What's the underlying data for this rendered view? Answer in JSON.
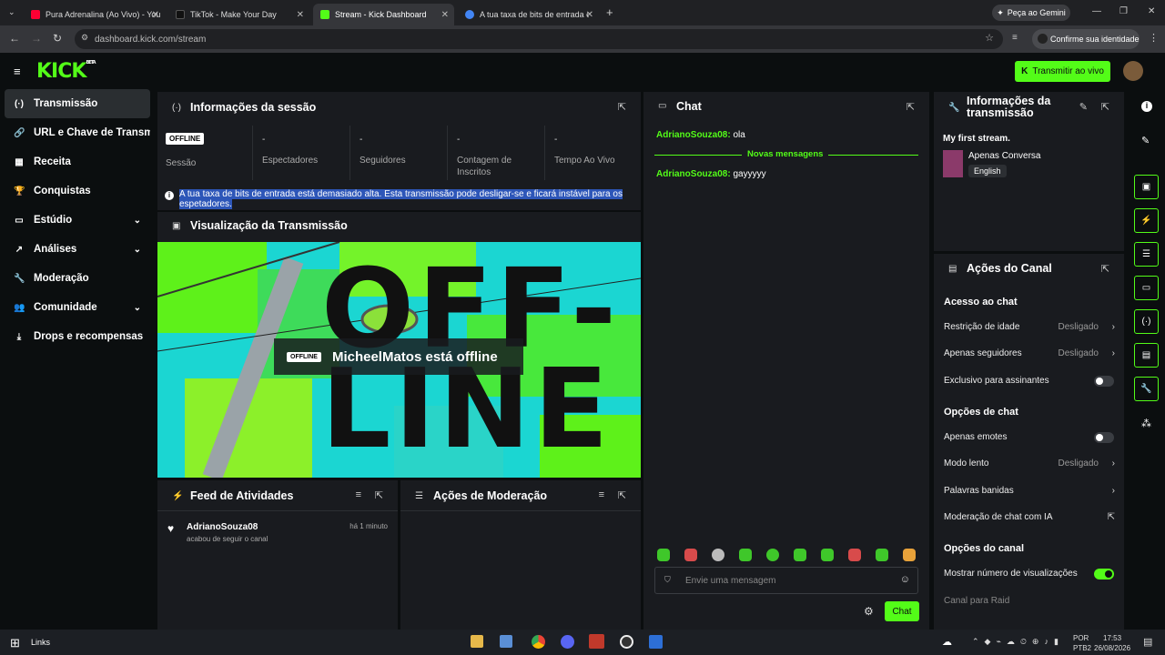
{
  "browser": {
    "tabs": [
      {
        "title": "Pura Adrenalina (Ao Vivo) - You",
        "color": "#ff0033"
      },
      {
        "title": "TikTok - Make Your Day",
        "color": "#000000"
      },
      {
        "title": "Stream - Kick Dashboard",
        "color": "#53fc18"
      },
      {
        "title": "A tua taxa de bits de entrada e",
        "color": "#4285f4"
      }
    ],
    "gemini": "Peça ao Gemini",
    "url": "dashboard.kick.com/stream",
    "identity": "Confirme sua identidade"
  },
  "header": {
    "logo": "KICK",
    "logo_tag": "BETA",
    "live_button": "Transmitir ao vivo"
  },
  "sidebar": {
    "items": [
      {
        "label": "Transmissão",
        "icon": "(·)"
      },
      {
        "label": "URL e Chave de Transmissão",
        "icon": "🔗"
      },
      {
        "label": "Receita",
        "icon": "▦"
      },
      {
        "label": "Conquistas",
        "icon": "🏆"
      },
      {
        "label": "Estúdio",
        "icon": "▭"
      },
      {
        "label": "Análises",
        "icon": "↗"
      },
      {
        "label": "Moderação",
        "icon": "🔧"
      },
      {
        "label": "Comunidade",
        "icon": "👥"
      },
      {
        "label": "Drops e recompensas",
        "icon": "⤓"
      }
    ]
  },
  "session": {
    "title": "Informações da sessão",
    "badge": "OFFLINE",
    "stats": [
      {
        "value": "",
        "label": "Sessão"
      },
      {
        "value": "-",
        "label": "Espectadores"
      },
      {
        "value": "-",
        "label": "Seguidores"
      },
      {
        "value": "-",
        "label": "Contagem de Inscritos"
      },
      {
        "value": "-",
        "label": "Tempo Ao Vivo"
      }
    ],
    "warning": "A tua taxa de bits de entrada está demasiado alta. Esta transmissão pode desligar-se e ficará instável para os espetadores."
  },
  "preview": {
    "title": "Visualização da Transmissão",
    "badge": "OFFLINE",
    "message": "MicheelMatos está offline",
    "bg_text": "OFF-LINE"
  },
  "feed": {
    "title": "Feed de Atividades",
    "user": "AdrianoSouza08",
    "time": "há 1 minuto",
    "action": "acabou de seguir o canal"
  },
  "moderation": {
    "title": "Ações de Moderação"
  },
  "chat": {
    "title": "Chat",
    "messages": [
      {
        "user": "AdrianoSouza08:",
        "text": "ola"
      },
      {
        "user": "AdrianoSouza08:",
        "text": "gayyyyy"
      }
    ],
    "divider": "Novas mensagens",
    "placeholder": "Envie uma mensagem",
    "send": "Chat"
  },
  "stream_info": {
    "title": "Informações da transmissão",
    "stream_title": "My first stream.",
    "category": "Apenas Conversa",
    "language": "English"
  },
  "channel_actions": {
    "title": "Ações do Canal",
    "chat_access": "Acesso ao chat",
    "age_restriction": {
      "label": "Restrição de idade",
      "value": "Desligado"
    },
    "followers_only": {
      "label": "Apenas seguidores",
      "value": "Desligado"
    },
    "subscribers_only": {
      "label": "Exclusivo para assinantes",
      "on": false
    },
    "chat_options": "Opções de chat",
    "emotes_only": {
      "label": "Apenas emotes",
      "on": false
    },
    "slow_mode": {
      "label": "Modo lento",
      "value": "Desligado"
    },
    "banned_words": {
      "label": "Palavras banidas"
    },
    "ai_moderation": {
      "label": "Moderação de chat com IA"
    },
    "channel_options": "Opções do canal",
    "show_views": {
      "label": "Mostrar número de visualizações",
      "on": true
    },
    "raid": "Canal para Raid"
  },
  "taskbar": {
    "links": "Links",
    "lang1": "POR",
    "lang2": "PTB2",
    "time": "17:53",
    "date": "26/08/2026"
  }
}
